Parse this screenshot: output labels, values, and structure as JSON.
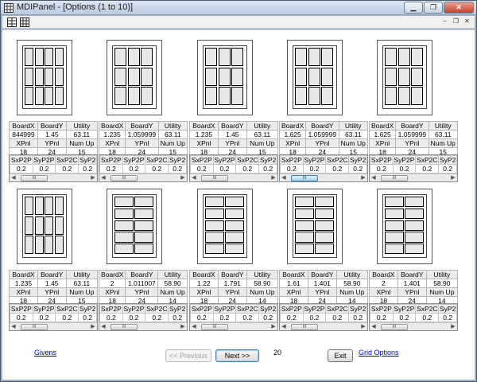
{
  "window": {
    "title": "MDIPanel - [Options (1 to 10)]"
  },
  "grid_headers": {
    "row1": [
      "BoardX",
      "BoardY",
      "Utility"
    ],
    "row2": [
      "XPnl",
      "YPnl",
      "Num Up"
    ],
    "row3": [
      "SxP2P",
      "SyP2P",
      "SxP2C",
      "SyP2"
    ]
  },
  "options": [
    {
      "boardx": "844999",
      "boardy": "1.45",
      "utility": "63.11",
      "xpnl": "18",
      "ypnl": "24",
      "numup": "15",
      "s": [
        "0.2",
        "0.2",
        "0.2",
        "0.2"
      ]
    },
    {
      "boardx": "1.235",
      "boardy": "1.059999",
      "utility": "63.11",
      "xpnl": "18",
      "ypnl": "24",
      "numup": "15",
      "s": [
        "0.2",
        "0.2",
        "0.2",
        "0.2"
      ]
    },
    {
      "boardx": "1.235",
      "boardy": "1.45",
      "utility": "63.11",
      "xpnl": "18",
      "ypnl": "24",
      "numup": "15",
      "s": [
        "0.2",
        "0.2",
        "0.2",
        "0.2"
      ]
    },
    {
      "boardx": "1.625",
      "boardy": "1.059999",
      "utility": "63.11",
      "xpnl": "18",
      "ypnl": "24",
      "numup": "15",
      "s": [
        "0.2",
        "0.2",
        "0.2",
        "0.2"
      ]
    },
    {
      "boardx": "1.625",
      "boardy": "1.059999",
      "utility": "63.11",
      "xpnl": "18",
      "ypnl": "24",
      "numup": "15",
      "s": [
        "0.2",
        "0.2",
        "0.2",
        "0.2"
      ]
    },
    {
      "boardx": "1.235",
      "boardy": "1.45",
      "utility": "63.11",
      "xpnl": "18",
      "ypnl": "24",
      "numup": "15",
      "s": [
        "0.2",
        "0.2",
        "0.2",
        "0.2"
      ]
    },
    {
      "boardx": "2",
      "boardy": "1.011007",
      "utility": "58.90",
      "xpnl": "18",
      "ypnl": "24",
      "numup": "14",
      "s": [
        "0.2",
        "0.2",
        "0.2",
        "0.2"
      ]
    },
    {
      "boardx": "1.22",
      "boardy": "1.791",
      "utility": "58.90",
      "xpnl": "18",
      "ypnl": "24",
      "numup": "14",
      "s": [
        "0.2",
        "0.2",
        "0.2",
        "0.2"
      ]
    },
    {
      "boardx": "1.61",
      "boardy": "1.401",
      "utility": "58.90",
      "xpnl": "18",
      "ypnl": "24",
      "numup": "14",
      "s": [
        "0.2",
        "0.2",
        "0.2",
        "0.2"
      ]
    },
    {
      "boardx": "2",
      "boardy": "1.401",
      "utility": "58.90",
      "xpnl": "18",
      "ypnl": "24",
      "numup": "14",
      "s": [
        "0.2",
        "0.2",
        "0.2",
        "0.2"
      ]
    }
  ],
  "footer": {
    "givens_link": "Givens",
    "previous_button": "<< Previous",
    "next_button": "Next >>",
    "count": "20",
    "exit_button": "Exit",
    "grid_options_link": "Grid Options"
  },
  "scroll_thumb_glyph": "III",
  "icons": [
    "app-grid-icon",
    "toolbar-tile-icon",
    "toolbar-cascade-icon",
    "minimize-icon",
    "restore-icon",
    "close-icon"
  ]
}
